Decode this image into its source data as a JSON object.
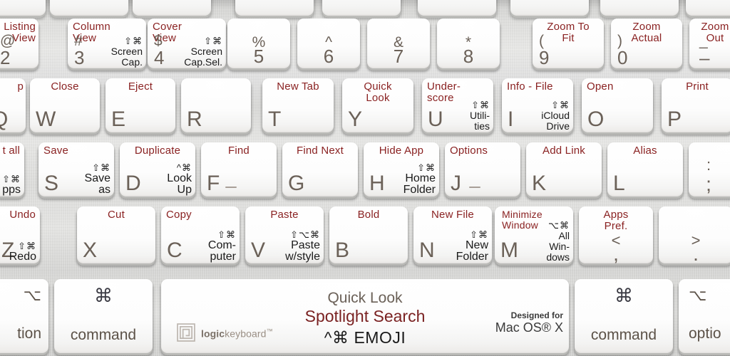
{
  "product": {
    "brand_bold": "logic",
    "brand_rest": "keyboard",
    "brand_tm": "™",
    "designed_line1": "Designed for",
    "designed_line2": "Mac OS® X",
    "accent_label_color": "#8a2222",
    "shortcut_color": "#1a1a1a",
    "legend_color": "#6b6158",
    "key_face_color": "#fdfdfd",
    "chassis_color": "#dcdcda"
  },
  "rows": {
    "number_row": [
      {
        "name": "key-2",
        "top": "Listing\nView",
        "upper": "@",
        "lower": "2"
      },
      {
        "name": "key-3",
        "top": "Column\nView",
        "upper": "#",
        "lower": "3",
        "mods": "⇧⌘",
        "shortcut": "Screen\nCap."
      },
      {
        "name": "key-4",
        "top": "Cover\nView",
        "upper": "$",
        "lower": "4",
        "mods": "⇧⌘",
        "shortcut": "Screen\nCap.Sel."
      },
      {
        "name": "key-5",
        "top": "",
        "upper": "%",
        "lower": "5"
      },
      {
        "name": "key-6",
        "top": "",
        "upper": "^",
        "lower": "6"
      },
      {
        "name": "key-7",
        "top": "",
        "upper": "&",
        "lower": "7"
      },
      {
        "name": "key-8",
        "top": "",
        "upper": "*",
        "lower": "8"
      },
      {
        "name": "key-9",
        "top": "Zoom To\nFit",
        "upper": "(",
        "lower": "9"
      },
      {
        "name": "key-0",
        "top": "Zoom\nActual",
        "upper": ")",
        "lower": "0"
      },
      {
        "name": "key-minus",
        "top": "Zoom\nOut",
        "upper": "_",
        "lower": "–"
      }
    ],
    "qwerty_row": [
      {
        "name": "key-q",
        "top": "p",
        "letter": "Q"
      },
      {
        "name": "key-w",
        "top": "Close",
        "letter": "W"
      },
      {
        "name": "key-e",
        "top": "Eject",
        "letter": "E"
      },
      {
        "name": "key-r",
        "top": "",
        "letter": "R"
      },
      {
        "name": "key-t",
        "top": "New Tab",
        "letter": "T"
      },
      {
        "name": "key-y",
        "top": "Quick\nLook",
        "letter": "Y"
      },
      {
        "name": "key-u",
        "top": "Under-\nscore",
        "letter": "U",
        "mods": "⇧⌘",
        "shortcut": "Utili-\nties"
      },
      {
        "name": "key-i",
        "top": "Info - File",
        "letter": "I",
        "mods": "⇧⌘",
        "shortcut": "iCloud\nDrive"
      },
      {
        "name": "key-o",
        "top": "Open",
        "letter": "O"
      },
      {
        "name": "key-p",
        "top": "Print",
        "letter": "P"
      }
    ],
    "home_row": [
      {
        "name": "key-a",
        "top": "t all",
        "letter": "A",
        "mods": "⇧⌘",
        "shortcut": "pps"
      },
      {
        "name": "key-s",
        "top": "Save",
        "letter": "S",
        "mods": "⇧⌘",
        "shortcut": "Save\nas"
      },
      {
        "name": "key-d",
        "top": "Duplicate",
        "letter": "D",
        "mods": "^⌘",
        "shortcut": "Look\nUp"
      },
      {
        "name": "key-f",
        "top": "Find",
        "letter": "F",
        "home_bar": true
      },
      {
        "name": "key-g",
        "top": "Find Next",
        "letter": "G"
      },
      {
        "name": "key-h",
        "top": "Hide App",
        "letter": "H",
        "mods": "⇧⌘",
        "shortcut": "Home\nFolder"
      },
      {
        "name": "key-j",
        "top": "Options",
        "letter": "J",
        "home_bar": true
      },
      {
        "name": "key-k",
        "top": "Add Link",
        "letter": "K"
      },
      {
        "name": "key-l",
        "top": "Alias",
        "letter": "L"
      },
      {
        "name": "key-semicolon",
        "top": "",
        "upper": ":",
        "lower": ";"
      }
    ],
    "bottom_letter_row": [
      {
        "name": "key-z",
        "top": "Undo",
        "letter": "Z",
        "mods": "⇧⌘",
        "shortcut": "Redo"
      },
      {
        "name": "key-x",
        "top": "Cut",
        "letter": "X"
      },
      {
        "name": "key-c",
        "top": "Copy",
        "letter": "C",
        "mods": "⇧⌘",
        "shortcut": "Com-\nputer"
      },
      {
        "name": "key-v",
        "top": "Paste",
        "letter": "V",
        "mods": "⇧⌥⌘",
        "shortcut": "Paste\nw/style"
      },
      {
        "name": "key-b",
        "top": "Bold",
        "letter": "B"
      },
      {
        "name": "key-n",
        "top": "New File",
        "letter": "N",
        "mods": "⇧⌘",
        "shortcut": "New\nFolder"
      },
      {
        "name": "key-m",
        "top": "Minimize\nWindow",
        "letter": "M",
        "mods": "⌥⌘",
        "shortcut": "All\nWin-\ndows"
      },
      {
        "name": "key-comma",
        "top": "Apps\nPref.",
        "upper": "<",
        "lower": ","
      },
      {
        "name": "key-period",
        "top": "",
        "upper": ">",
        "lower": "."
      }
    ],
    "modifier_row": {
      "option_left": {
        "name": "key-option-left",
        "symbol": "⌥",
        "label": "tion"
      },
      "command_left": {
        "name": "key-command-left",
        "symbol": "⌘",
        "label": "command"
      },
      "spacebar": {
        "name": "key-spacebar",
        "quick_look": "Quick Look",
        "spotlight": "Spotlight Search",
        "emoji_mods": "^⌘",
        "emoji_label": "EMOJI"
      },
      "command_right": {
        "name": "key-command-right",
        "symbol": "⌘",
        "label": "command"
      },
      "option_right": {
        "name": "key-option-right",
        "symbol": "⌥",
        "label": "optio"
      }
    }
  }
}
